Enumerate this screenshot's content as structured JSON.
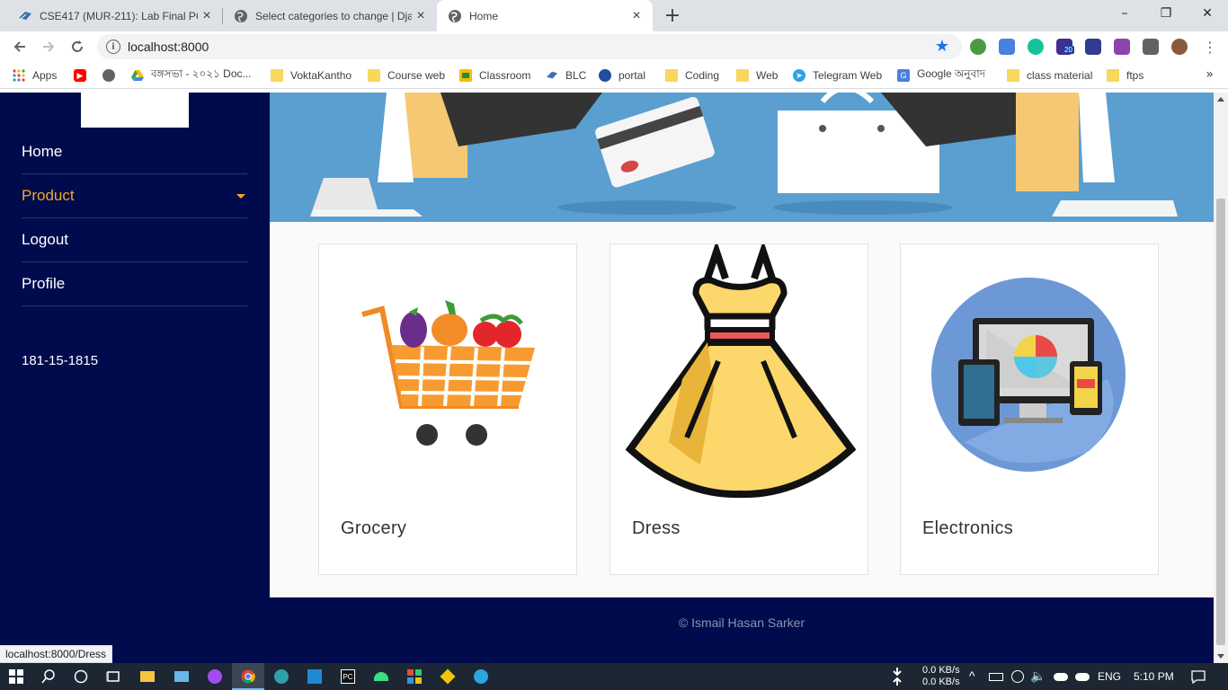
{
  "browser": {
    "tabs": [
      {
        "title": "CSE417 (MUR-211): Lab Final PC-",
        "active": false,
        "icon": "edu-icon"
      },
      {
        "title": "Select categories to change | Dja",
        "active": false,
        "icon": "globe-icon"
      },
      {
        "title": "Home",
        "active": true,
        "icon": "globe-icon"
      }
    ],
    "new_tab": "+",
    "window_controls": {
      "minimize": "–",
      "maximize": "❐",
      "close": "✕"
    },
    "url": "localhost:8000",
    "bookmarks": [
      {
        "label": "Apps",
        "icon": "apps-grid-icon"
      },
      {
        "label": "",
        "icon": "youtube-icon"
      },
      {
        "label": "",
        "icon": "globe-icon"
      },
      {
        "label": "বঙ্গসভা - ২০২১ Doc...",
        "icon": "drive-icon"
      },
      {
        "label": "VoktaKantho",
        "icon": "folder-icon"
      },
      {
        "label": "Course web",
        "icon": "folder-icon"
      },
      {
        "label": "Classroom",
        "icon": "classroom-icon"
      },
      {
        "label": "BLC",
        "icon": "edu-icon"
      },
      {
        "label": "portal",
        "icon": "portal-icon"
      },
      {
        "label": "Coding",
        "icon": "folder-icon"
      },
      {
        "label": "Web",
        "icon": "folder-icon"
      },
      {
        "label": "Telegram Web",
        "icon": "telegram-icon"
      },
      {
        "label": "Google অনুবাদ",
        "icon": "translate-icon"
      },
      {
        "label": "class material",
        "icon": "folder-icon"
      },
      {
        "label": "ftps",
        "icon": "folder-icon"
      }
    ],
    "bookmarks_more": "»",
    "status_url": "localhost:8000/Dress",
    "extension_badge": "20"
  },
  "sidebar": {
    "items": [
      {
        "label": "Home",
        "active": false
      },
      {
        "label": "Product",
        "active": true,
        "has_dropdown": true
      },
      {
        "label": "Logout",
        "active": false
      },
      {
        "label": "Profile",
        "active": false
      }
    ],
    "student_id": "181-15-1815"
  },
  "categories": [
    {
      "label": "Grocery",
      "image": "grocery-cart-image"
    },
    {
      "label": "Dress",
      "image": "dress-image"
    },
    {
      "label": "Electronics",
      "image": "electronics-image"
    }
  ],
  "footer": {
    "copyright": "© Ismail Hasan Sarker"
  },
  "taskbar": {
    "net_down": "0.0 KB/s",
    "net_up": "0.0 KB/s",
    "language": "ENG",
    "time": "5:10 PM"
  },
  "colors": {
    "sidebar_bg": "#000b4d",
    "accent": "#f5a623",
    "hero_bg": "#5a9fd0"
  }
}
